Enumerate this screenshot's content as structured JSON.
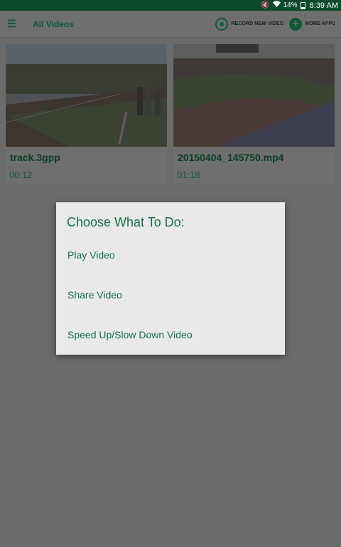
{
  "status_bar": {
    "battery_text": "14%",
    "time": "8:39 AM",
    "icons": [
      "mute-vibrate-icon",
      "wifi-icon",
      "battery-icon"
    ]
  },
  "app_bar": {
    "menu_icon": "menu-icon",
    "title": "All Videos",
    "record_label": "RECORD NEW VIDEO",
    "more_apps_label": "MORE APPS"
  },
  "videos": [
    {
      "title": "track.3gpp",
      "duration": "00:12"
    },
    {
      "title": "20150404_145750.mp4",
      "duration": "01:18"
    }
  ],
  "dialog": {
    "title": "Choose What To Do:",
    "options": [
      "Play Video",
      "Share Video",
      "Speed Up/Slow Down Video"
    ]
  },
  "colors": {
    "accent_green": "#117044",
    "status_bar": "#0b4a2c",
    "overlay_gray": "#6b6b6b"
  }
}
